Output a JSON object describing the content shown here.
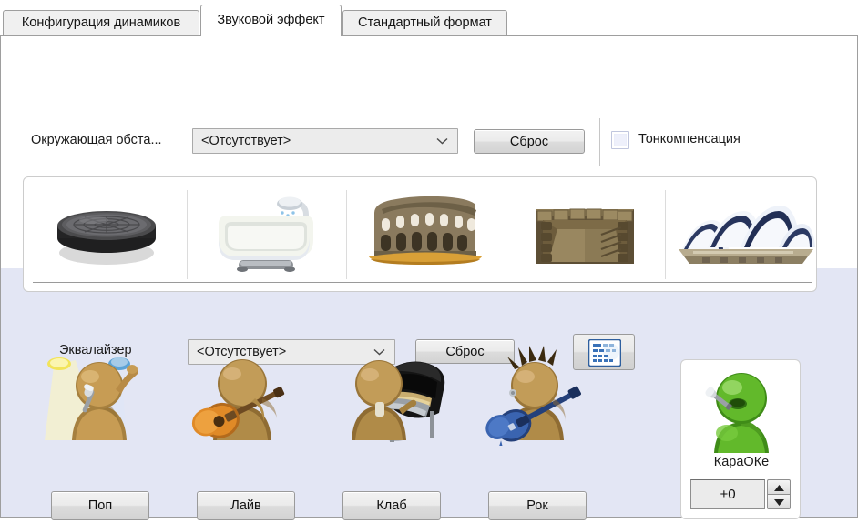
{
  "tabs": [
    {
      "label": "Конфигурация динамиков",
      "selected": false
    },
    {
      "label": "Звуковой эффект",
      "selected": true
    },
    {
      "label": "Стандартный формат",
      "selected": false
    }
  ],
  "environment": {
    "label": "Окружающая обста...",
    "value": "<Отсутствует>",
    "reset_label": "Сброс",
    "loudness_label": "Тонкомпенсация",
    "loudness_checked": false
  },
  "environment_presets": [
    {
      "name": "stone-disc-icon",
      "caption": ""
    },
    {
      "name": "bathtub-shower-icon",
      "caption": ""
    },
    {
      "name": "colosseum-icon",
      "caption": ""
    },
    {
      "name": "stone-arena-icon",
      "caption": ""
    },
    {
      "name": "sydney-opera-house-icon",
      "caption": ""
    }
  ],
  "equalizer": {
    "label": "Эквалайзер",
    "value": "<Отсутствует>",
    "reset_label": "Сброс",
    "editor_icon": "equalizer-mixer-icon"
  },
  "equalizer_presets": [
    {
      "button_label": "Поп",
      "icon": "singer-spotlight-icon"
    },
    {
      "button_label": "Лайв",
      "icon": "acoustic-guitar-icon"
    },
    {
      "button_label": "Клаб",
      "icon": "grand-piano-icon"
    },
    {
      "button_label": "Рок",
      "icon": "punk-electric-guitar-icon"
    }
  ],
  "karaoke": {
    "label": "КараОКе",
    "icon": "green-singer-icon",
    "value": "+0",
    "up_label": "▲",
    "down_label": "▼"
  },
  "colors": {
    "lower_background": "#e3e6f4",
    "panel_background": "#ffffff",
    "border": "#9e9e9e",
    "karaoke_green": "#5cb327"
  }
}
